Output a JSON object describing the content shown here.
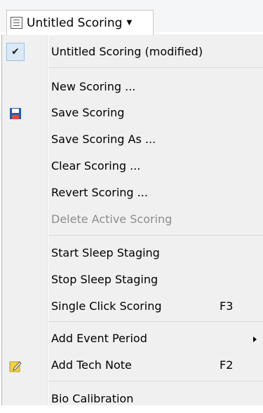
{
  "toolbar": {
    "dropdown_label": "Untitled Scoring",
    "icon": "document-list-icon"
  },
  "menu": {
    "items": [
      {
        "label": "Untitled Scoring (modified)",
        "checked": true
      },
      {
        "label": "New Scoring ..."
      },
      {
        "label": "Save Scoring",
        "icon": "save-icon"
      },
      {
        "label": "Save Scoring As ..."
      },
      {
        "label": "Clear Scoring ..."
      },
      {
        "label": "Revert Scoring ..."
      },
      {
        "label": "Delete Active Scoring",
        "disabled": true
      },
      {
        "label": "Start Sleep Staging"
      },
      {
        "label": "Stop Sleep Staging"
      },
      {
        "label": "Single Click Scoring",
        "shortcut": "F3"
      },
      {
        "label": "Add Event Period",
        "submenu": true
      },
      {
        "label": "Add Tech Note",
        "shortcut": "F2",
        "icon": "note-edit-icon"
      },
      {
        "label": "Bio Calibration"
      }
    ]
  },
  "colors": {
    "menu_background": "#f0f0f0",
    "check_highlight": "#dbe9f7",
    "disabled_text": "#8d8d8d",
    "save_icon_blue": "#1d5fb0",
    "note_icon_yellow": "#f3d23c"
  }
}
